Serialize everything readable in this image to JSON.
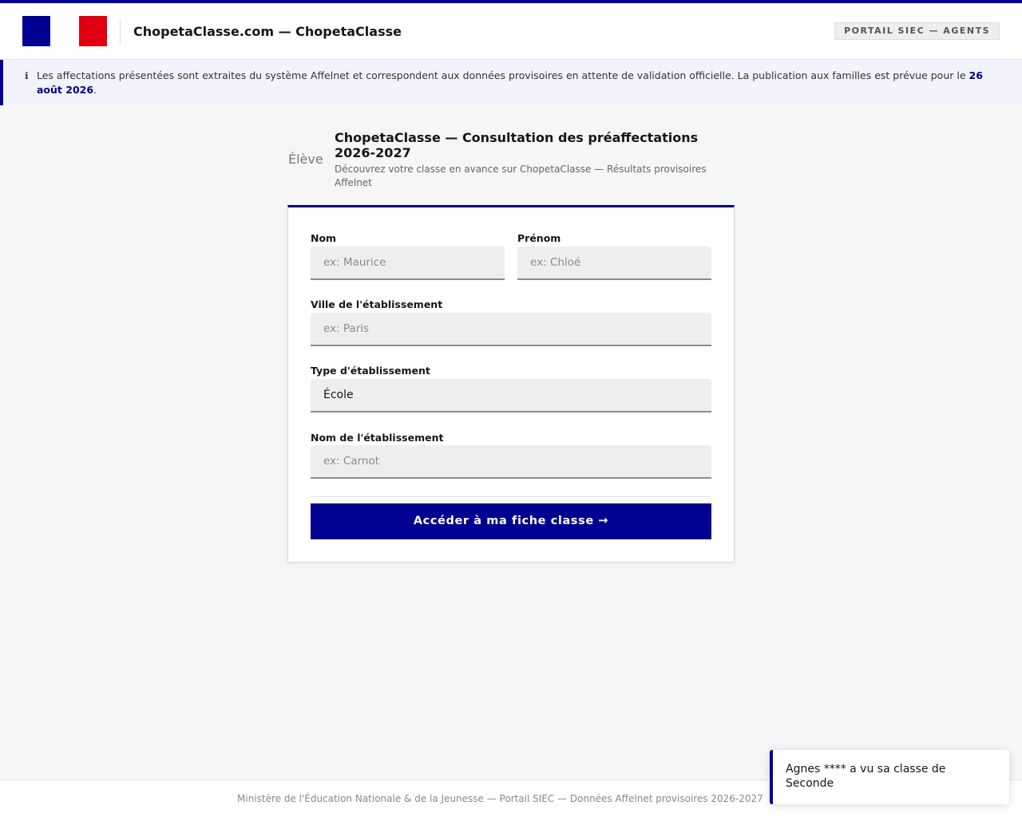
{
  "header": {
    "site_title": "ChopetaClasse.com — ChopetaClasse",
    "portal_badge": "PORTAIL SIEC — AGENTS",
    "flag_colors": [
      "#000091",
      "#ffffff",
      "#e1000f"
    ]
  },
  "notice": {
    "icon": "info-icon",
    "icon_glyph": "ℹ",
    "text": "Les affectations présentées sont extraites du système Affelnet et correspondent aux données provisoires en attente de validation officielle. La publication aux familles est prévue pour le ",
    "date": "26 août 2026",
    "tail": "."
  },
  "page": {
    "eleve_label": "Élève",
    "title": "ChopetaClasse — Consultation des préaffectations 2026-2027",
    "subtitle": "Découvrez votre classe en avance sur ChopetaClasse — Résultats provisoires Affelnet"
  },
  "form": {
    "nom": {
      "label": "Nom",
      "placeholder": "ex: Maurice",
      "value": ""
    },
    "prenom": {
      "label": "Prénom",
      "placeholder": "ex: Chloé",
      "value": ""
    },
    "ville": {
      "label": "Ville de l'établissement",
      "placeholder": "ex: Paris",
      "value": ""
    },
    "type": {
      "label": "Type d'établissement",
      "selected": "École"
    },
    "etablissement": {
      "label": "Nom de l'établissement",
      "placeholder": "ex: Carnot",
      "value": ""
    },
    "submit_label": "Accéder à ma fiche classe →"
  },
  "footer": {
    "text": "Ministère de l'Éducation Nationale & de la Jeunesse  —  Portail SIEC  —  Données Affelnet provisoires 2026-2027"
  },
  "toast": {
    "text": "Agnes **** a vu sa classe de Seconde"
  },
  "colors": {
    "accent": "#000091",
    "red": "#e1000f",
    "notice_bg": "#f3f3fd"
  }
}
